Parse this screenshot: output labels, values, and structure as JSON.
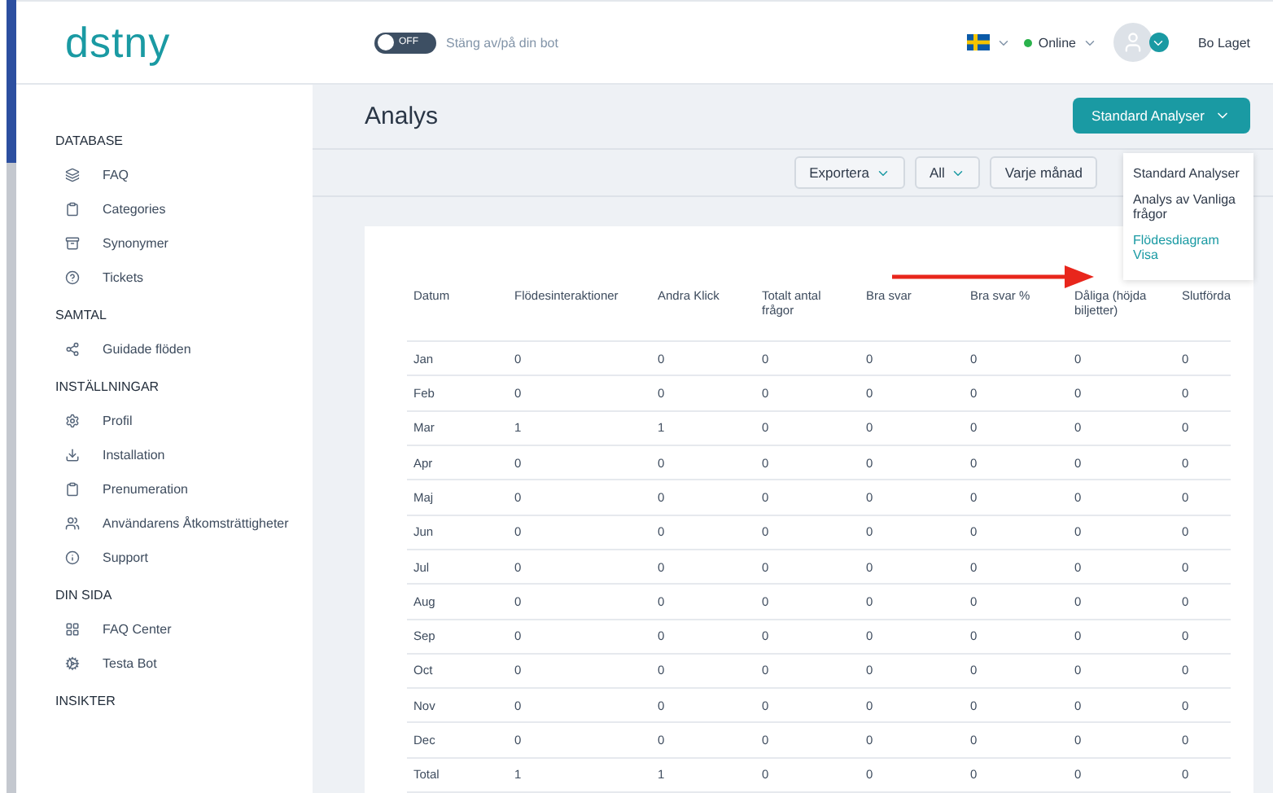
{
  "header": {
    "logo": "dstny",
    "bot_toggle": {
      "on": false,
      "label": "OFF",
      "caption": "Stäng av/på din bot"
    },
    "status": "Online",
    "user": "Bo Laget"
  },
  "sidebar": [
    {
      "heading": "DATABASE",
      "items": [
        {
          "label": "FAQ",
          "kind": "layers"
        },
        {
          "label": "Categories",
          "kind": "clipboard"
        },
        {
          "label": "Synonymer",
          "kind": "stack"
        },
        {
          "label": "Tickets",
          "kind": "help"
        }
      ]
    },
    {
      "heading": "SAMTAL",
      "items": [
        {
          "label": "Guidade flöden",
          "kind": "share"
        }
      ]
    },
    {
      "heading": "INSTÄLLNINGAR",
      "items": [
        {
          "label": "Profil",
          "kind": "gear"
        },
        {
          "label": "Installation",
          "kind": "download"
        },
        {
          "label": "Prenumeration",
          "kind": "clipboard"
        },
        {
          "label": "Användarens Åtkomsträttigheter",
          "kind": "users"
        },
        {
          "label": "Support",
          "kind": "info"
        }
      ]
    },
    {
      "heading": "DIN SIDA",
      "items": [
        {
          "label": "FAQ Center",
          "kind": "grid"
        },
        {
          "label": "Testa Bot",
          "kind": "cogs"
        }
      ]
    },
    {
      "heading": "INSIKTER"
    }
  ],
  "page_title": "Analys",
  "analysis_button": "Standard Analyser",
  "analysis_menu": [
    {
      "label": "Standard Analyser",
      "selected": false
    },
    {
      "label": "Analys av Vanliga frågor",
      "selected": false
    },
    {
      "label": "Flödesdiagram Visa",
      "selected": true
    }
  ],
  "filters": [
    "Exportera",
    "All",
    "Varje månad"
  ],
  "table": {
    "columns": [
      "Datum",
      "Flödesinteraktioner",
      "Andra Klick",
      "Totalt antal frågor",
      "Bra svar",
      "Bra svar %",
      "Dåliga (höjda biljetter)",
      "Slutförda"
    ],
    "rows": [
      [
        "Jan",
        "0",
        "0",
        "0",
        "0",
        "0",
        "0",
        "0"
      ],
      [
        "Feb",
        "0",
        "0",
        "0",
        "0",
        "0",
        "0",
        "0"
      ],
      [
        "Mar",
        "1",
        "1",
        "0",
        "0",
        "0",
        "0",
        "0"
      ],
      [
        "Apr",
        "0",
        "0",
        "0",
        "0",
        "0",
        "0",
        "0"
      ],
      [
        "Maj",
        "0",
        "0",
        "0",
        "0",
        "0",
        "0",
        "0"
      ],
      [
        "Jun",
        "0",
        "0",
        "0",
        "0",
        "0",
        "0",
        "0"
      ],
      [
        "Jul",
        "0",
        "0",
        "0",
        "0",
        "0",
        "0",
        "0"
      ],
      [
        "Aug",
        "0",
        "0",
        "0",
        "0",
        "0",
        "0",
        "0"
      ],
      [
        "Sep",
        "0",
        "0",
        "0",
        "0",
        "0",
        "0",
        "0"
      ],
      [
        "Oct",
        "0",
        "0",
        "0",
        "0",
        "0",
        "0",
        "0"
      ],
      [
        "Nov",
        "0",
        "0",
        "0",
        "0",
        "0",
        "0",
        "0"
      ],
      [
        "Dec",
        "0",
        "0",
        "0",
        "0",
        "0",
        "0",
        "0"
      ],
      [
        "Total",
        "1",
        "1",
        "0",
        "0",
        "0",
        "0",
        "0"
      ]
    ]
  }
}
